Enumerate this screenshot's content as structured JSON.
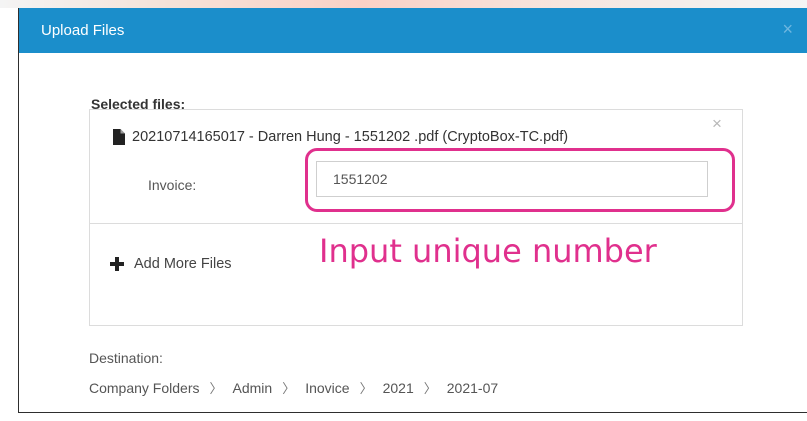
{
  "modal": {
    "title": "Upload Files",
    "close_glyph": "×"
  },
  "files": {
    "section_label": "Selected files:",
    "items": [
      {
        "icon": "file-icon",
        "name": "20210714165017 - Darren Hung - 1551202 .pdf (CryptoBox-TC.pdf)",
        "remove_glyph": "×",
        "invoice_label": "Invoice:",
        "invoice_value": "1551202"
      }
    ],
    "add_more_label": "Add More Files",
    "add_more_icon": "plus-icon"
  },
  "annotation": {
    "text": "Input unique number",
    "color": "#e0308d"
  },
  "destination": {
    "label": "Destination:",
    "path": [
      "Company Folders",
      "Admin",
      "Inovice",
      "2021",
      "2021-07"
    ],
    "separator": "〉"
  },
  "colors": {
    "header_bg": "#1b8ecb",
    "header_text": "#ffffff",
    "highlight": "#e0308d"
  }
}
